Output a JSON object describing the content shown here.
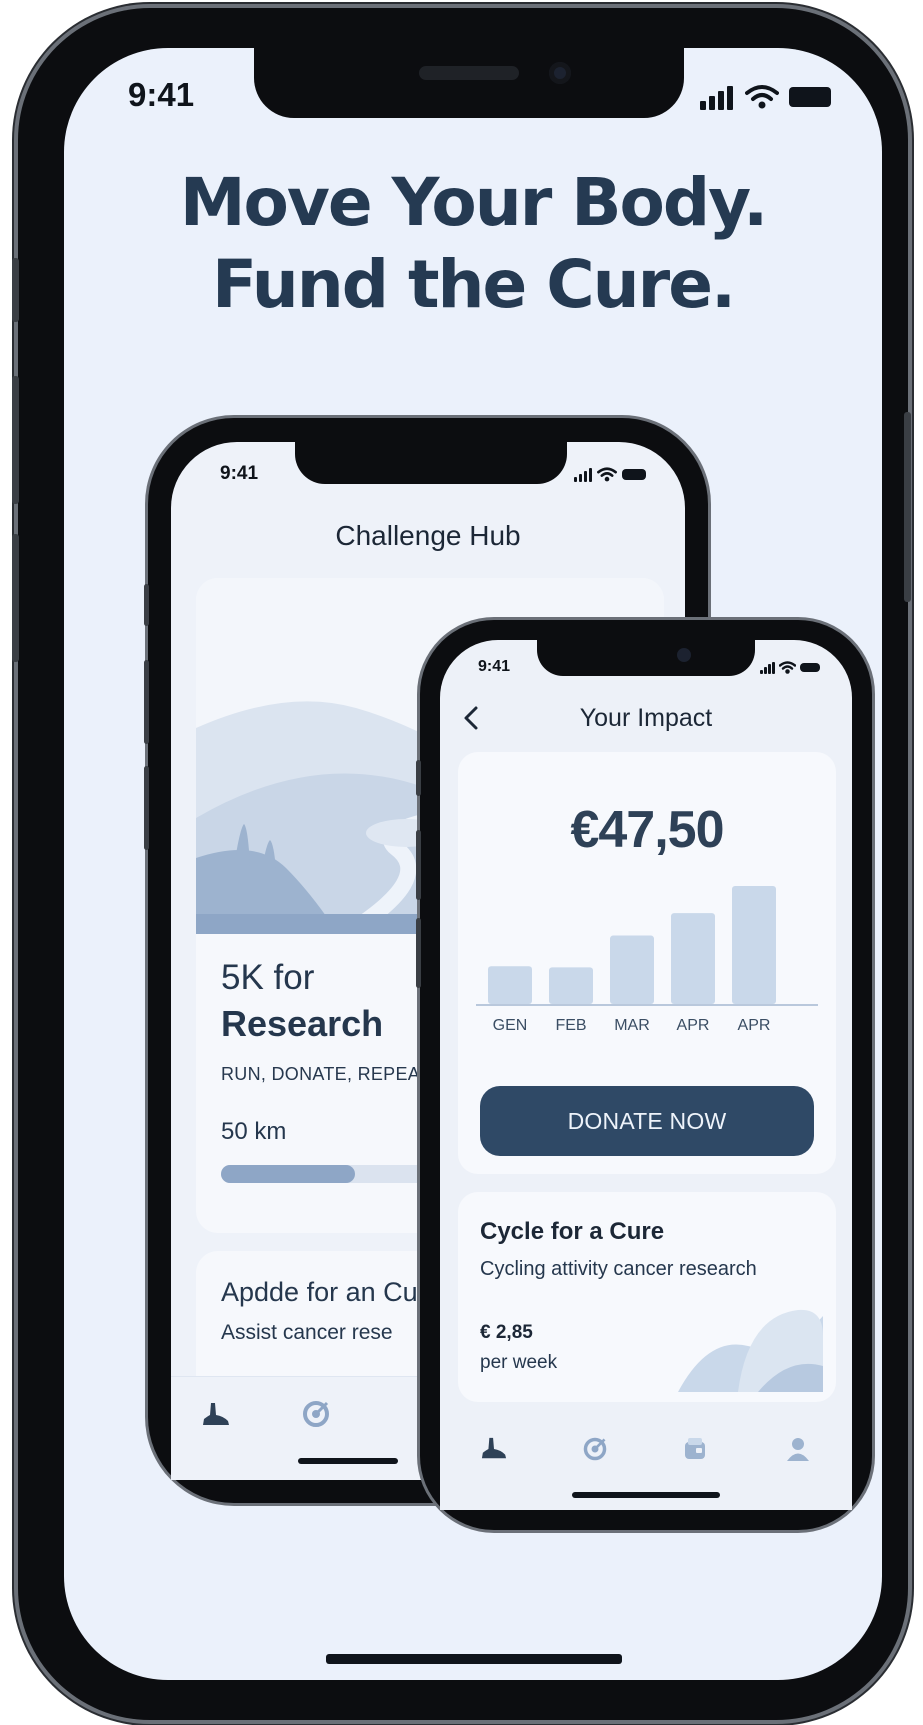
{
  "colors": {
    "screen_bg": "#ebf1fb",
    "headline": "#253a52",
    "accent": "#2f4966",
    "bar": "#c9d8ea",
    "progress": "#8ea6c6"
  },
  "outer": {
    "status_time": "9:41",
    "headline_line1": "Move Your Body.",
    "headline_line2": "Fund the Cure."
  },
  "back_phone": {
    "status_time": "9:41",
    "screen_title": "Challenge Hub",
    "challenge": {
      "name_part1": "5K for",
      "name_part2": "Research",
      "tagline": "RUN, DONATE, REPEA",
      "distance": "50 km",
      "progress_fraction": 0.32
    },
    "next_card": {
      "title": "Apdde for an Cu",
      "subtitle": "Assist cancer rese"
    },
    "nav_icons": [
      "shoe-icon",
      "target-icon"
    ]
  },
  "front_phone": {
    "status_time": "9:41",
    "screen_title": "Your Impact",
    "impact_amount": "€47,50",
    "donate_label": "DONATE NOW",
    "cycle_card": {
      "title": "Cycle for a Cure",
      "subtitle": "Cycling attivity cancer research",
      "amount": "€ 2,85",
      "period": "per week"
    },
    "nav_icons": [
      "shoe-icon",
      "target-icon",
      "wallet-icon",
      "profile-icon"
    ]
  },
  "chart_data": {
    "type": "bar",
    "categories": [
      "GEN",
      "FEB",
      "MAR",
      "APR",
      "APR"
    ],
    "values": [
      32,
      31,
      58,
      77,
      100
    ],
    "title": "",
    "xlabel": "",
    "ylabel": "",
    "ylim": [
      0,
      100
    ],
    "grid": false
  }
}
